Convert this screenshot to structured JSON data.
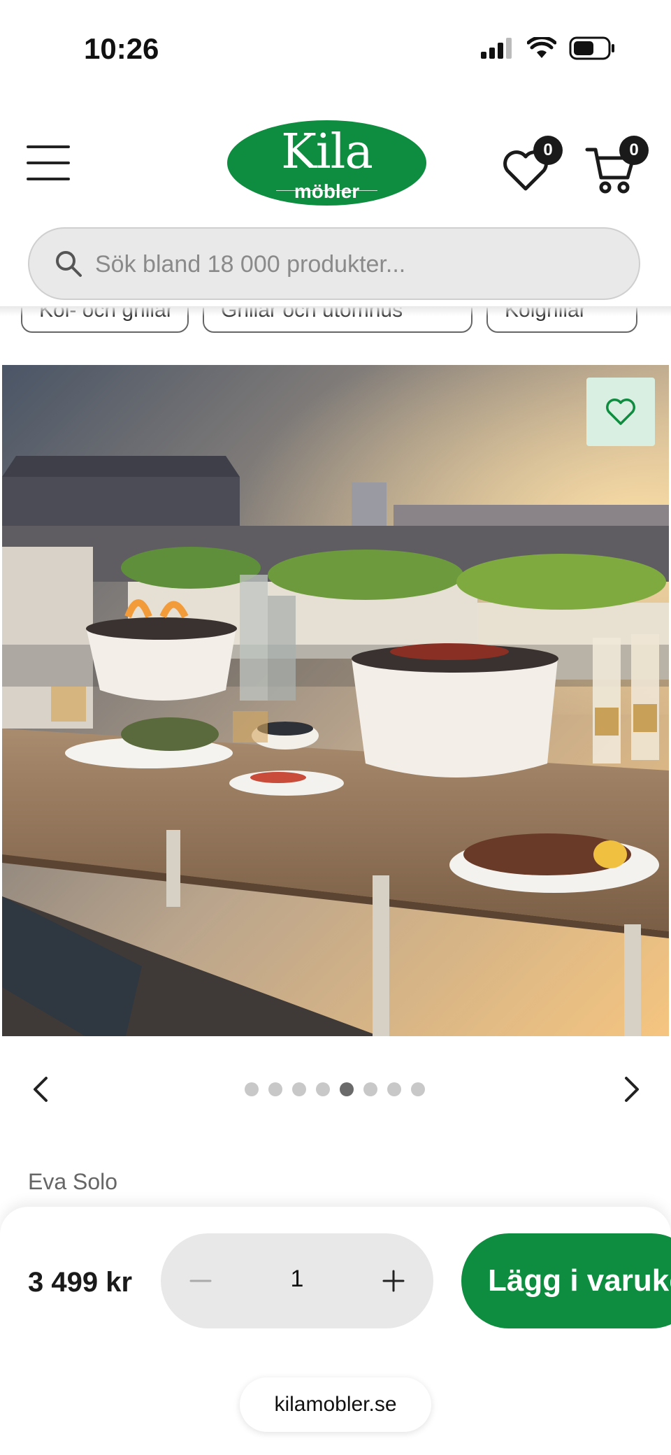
{
  "status_bar": {
    "time": "10:26"
  },
  "header": {
    "logo_main": "Kila",
    "logo_sub": "möbler",
    "wishlist_count": "0",
    "cart_count": "0"
  },
  "search": {
    "placeholder": "Sök bland 18 000 produkter..."
  },
  "chips": [
    "Kol- och grillar",
    "Grillar och utomhus",
    "Kolgrillar"
  ],
  "product": {
    "image_alt": "Eva Solo bordsgrill på en takterrass i solnedgång",
    "carousel_total": 8,
    "carousel_active": 5,
    "brand": "Eva Solo",
    "price": "3 499 kr",
    "quantity": "1",
    "add_to_cart": "Lägg i varukorg"
  },
  "browser": {
    "url": "kilamobler.se"
  },
  "colors": {
    "brand_green": "#0e8c3f",
    "fav_bg": "#d9efe1"
  }
}
